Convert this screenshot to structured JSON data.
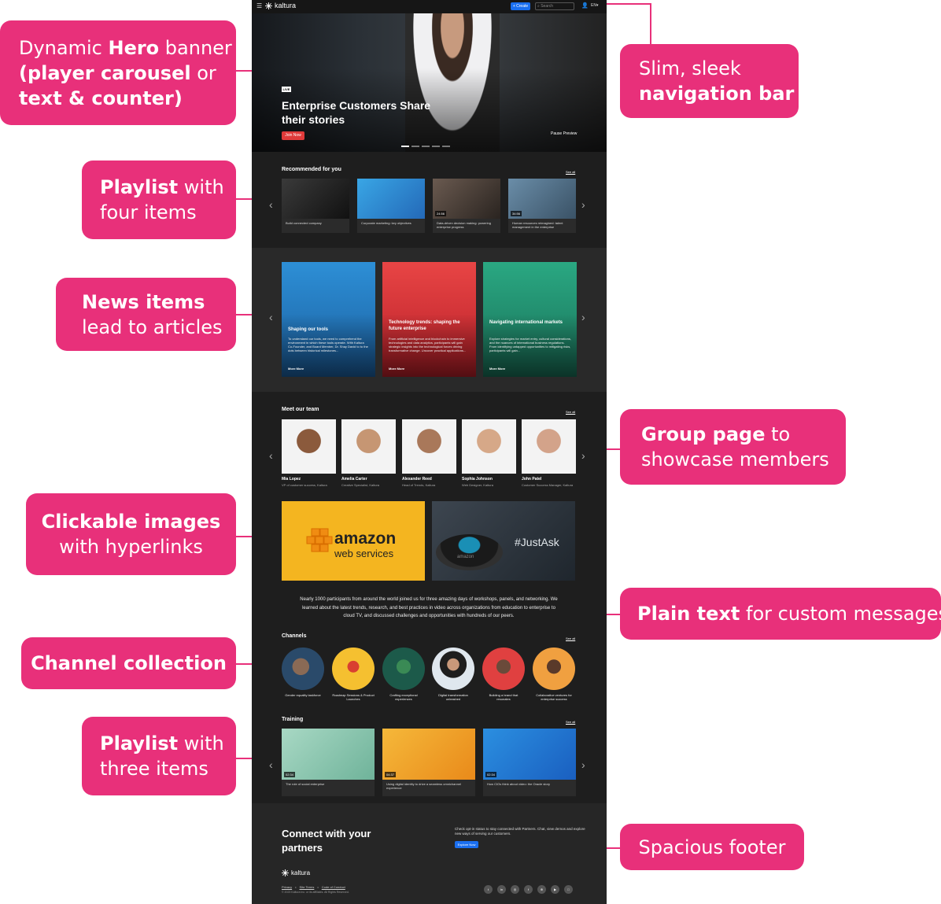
{
  "callouts": {
    "hero": {
      "l1": "Dynamic ",
      "l1b": "Hero",
      "l1c": " banner",
      "l2a": "(",
      "l2b": "player carousel",
      "l2c": " or",
      "l3": "text & counter)"
    },
    "playlist4": {
      "b": "Playlist",
      "n": " with",
      "l2": "four items"
    },
    "news": {
      "b": "News items",
      "l2": "lead to articles"
    },
    "images": {
      "b": "Clickable images",
      "l2": "with hyperlinks"
    },
    "channel": {
      "b": "Channel collection"
    },
    "playlist3": {
      "b": "Playlist",
      "n": " with",
      "l2": "three items"
    },
    "navbar": {
      "l1": "Slim, sleek",
      "l2": "navigation bar"
    },
    "group": {
      "b": "Group page",
      "n": " to",
      "l2": "showcase members"
    },
    "plaintext": {
      "b": "Plain text",
      "n": " for custom messages"
    },
    "footer": {
      "l1": "Spacious footer"
    }
  },
  "site": {
    "nav": {
      "logo": "kaltura",
      "create": "+ Create",
      "search_placeholder": "Search",
      "lang": "EN"
    },
    "hero": {
      "badge": "LIVE",
      "title": "Enterprise Customers Share their stories",
      "cta": "Join Now",
      "pause": "Pause Preview"
    },
    "recommended": {
      "title": "Recommended for you",
      "see_all": "See all",
      "items": [
        {
          "caption": "Build connected company",
          "duration": ""
        },
        {
          "caption": "Corporate marketing: key objectives",
          "duration": ""
        },
        {
          "caption": "Data-driven decision making: powering enterprise progress",
          "duration": "24:56"
        },
        {
          "caption": "Human resources reimagined: talent management in the enterprise",
          "duration": "34:56"
        }
      ]
    },
    "news": [
      {
        "title": "Shaping our tools",
        "body": "To understand our tools, we need to comprehend the environment in which these tools operate. With Kaltura Co-Founder, and Board Member, Dr. Shay David to to the dots between historical milestones...",
        "more": "More More"
      },
      {
        "title": "Technology trends: shaping the future enterprise",
        "body": "From artificial intelligence and blockchain to immersive technologies and data analytics, participants will gain strategic insights into the technological forces driving transformative change. Uncover practical applications...",
        "more": "More More"
      },
      {
        "title": "Navigating international markets",
        "body": "Explore strategies for market entry, cultural considerations, and the nuances of international business regulations. From identifying untapped opportunities to mitigating risks, participants will gain...",
        "more": "More More"
      }
    ],
    "team": {
      "title": "Meet our team",
      "see_all": "See all",
      "members": [
        {
          "name": "Mia Lopez",
          "role": "VP of customer success, Kaltura"
        },
        {
          "name": "Amelia Carter",
          "role": "Creative Specialist, Kaltura"
        },
        {
          "name": "Alexander Reed",
          "role": "Head of Trends, Kaltura"
        },
        {
          "name": "Sophia Johnson",
          "role": "Web Designer, Kaltura"
        },
        {
          "name": "John Patel",
          "role": "Customer Success Manager, Kaltura"
        }
      ]
    },
    "promos": {
      "aws_1": "amazon",
      "aws_2": "web services",
      "alexa": "#JustAsk",
      "alexa_brand": "amazon"
    },
    "plain_text": "Nearly 1000 participants from around the world joined us for three amazing days of workshops, panels, and networking. We learned about the latest trends, research, and best practices in video across organizations from education to enterprise to cloud TV, and discussed challenges and opportunities with hundreds of our peers.",
    "channels": {
      "title": "Channels",
      "see_all": "See all",
      "items": [
        {
          "label": "Gender equality taskforce"
        },
        {
          "label": "Roadmap Sessions & Product Launches"
        },
        {
          "label": "Crafting exceptional experiences"
        },
        {
          "label": "Digital transformation unleashed"
        },
        {
          "label": "Building a brand that resonates"
        },
        {
          "label": "Collaborative ventures for enterprise success"
        }
      ]
    },
    "training": {
      "title": "Training",
      "see_all": "See all",
      "items": [
        {
          "caption": "The role of social enterprise",
          "duration": "02:34"
        },
        {
          "caption": "Using digital identity to drive a seamless omnichannel experience",
          "duration": "04:37"
        },
        {
          "caption": "How CIOs think about video: the Oracle story",
          "duration": "02:34"
        }
      ]
    },
    "footer": {
      "title": "Connect with your partners",
      "desc": "Check opt-in status to stay connected with Partners. Chat, view demos and explore new ways of serving our customers.",
      "button": "Explore Now",
      "logo": "kaltura",
      "links": [
        "Privacy",
        "Site Terms",
        "Code of Conduct"
      ],
      "copyright": "© 2023 Kaltura Inc. or its affiliates. All Rights Reserved."
    }
  },
  "colors": {
    "accent": "#e8307a",
    "site_bg": "#1e1e1e",
    "primary_button": "#1a6ff0",
    "live_red": "#e03a3a"
  }
}
